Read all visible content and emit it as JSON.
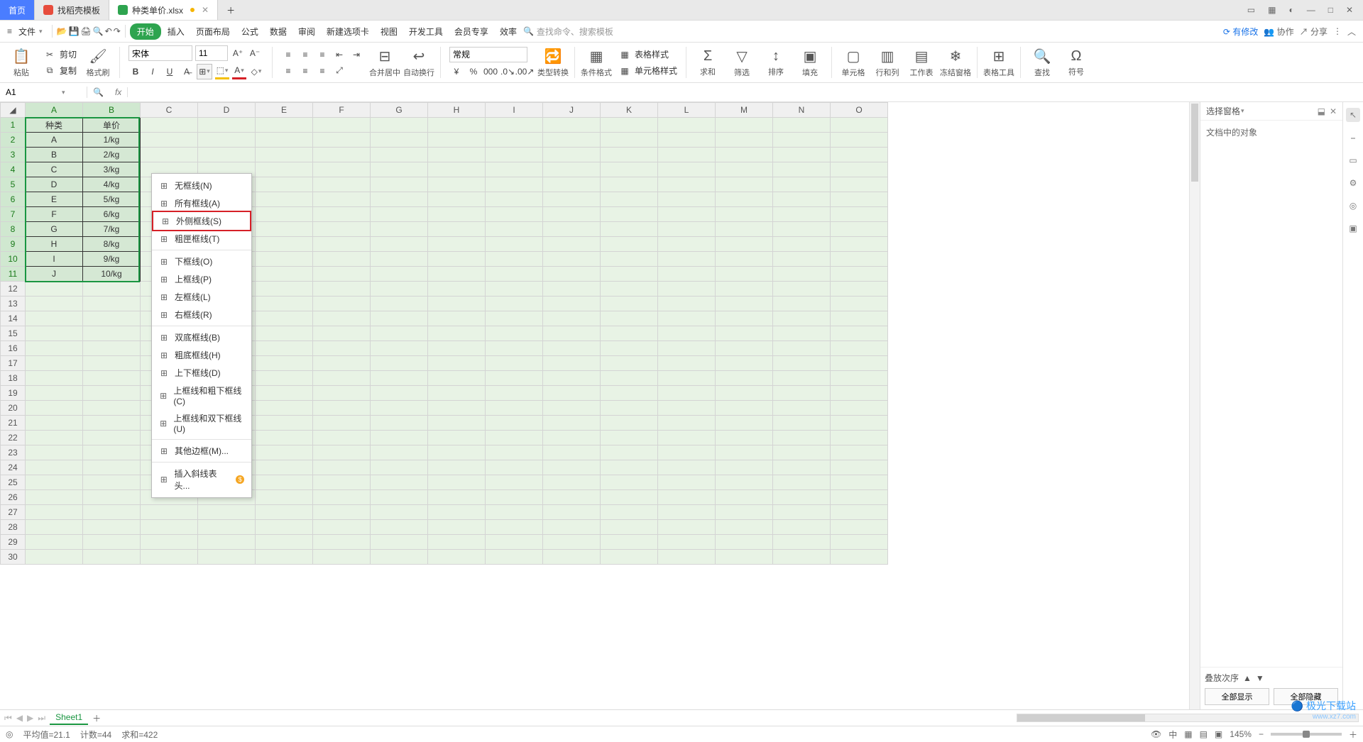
{
  "titlebar": {
    "tabs": [
      {
        "label": "首页",
        "icon_color": "#4a7dff"
      },
      {
        "label": "找稻壳模板",
        "icon_color": "#e74c3c"
      },
      {
        "label": "种类单价.xlsx",
        "icon_color": "#2ea44f"
      }
    ],
    "wincontrols": [
      "▭",
      "⊞",
      "◧",
      "—",
      "□",
      "✕"
    ]
  },
  "menubar": {
    "file": "文件",
    "tabs": [
      "开始",
      "插入",
      "页面布局",
      "公式",
      "数据",
      "审阅",
      "新建选项卡",
      "视图",
      "开发工具",
      "会员专享",
      "效率"
    ],
    "search_placeholder": "查找命令、搜索模板",
    "right": {
      "has_changes": "有修改",
      "collab": "协作",
      "share": "分享"
    }
  },
  "ribbon": {
    "paste": "粘贴",
    "cut": "剪切",
    "copy": "复制",
    "format_painter": "格式刷",
    "font_name": "宋体",
    "font_size": "11",
    "number_format": "常规",
    "merge": "合并居中",
    "wrap": "自动换行",
    "type_convert": "类型转换",
    "cond_fmt": "条件格式",
    "table_style": "表格样式",
    "cell_style": "单元格样式",
    "sum": "求和",
    "filter": "筛选",
    "sort": "排序",
    "fill": "填充",
    "cell": "单元格",
    "row_col": "行和列",
    "sheet": "工作表",
    "freeze": "冻结窗格",
    "table_tools": "表格工具",
    "find": "查找",
    "symbol": "符号"
  },
  "namebox": {
    "cell": "A1"
  },
  "columns": [
    "A",
    "B",
    "C",
    "D",
    "E",
    "F",
    "G",
    "H",
    "I",
    "J",
    "K",
    "L",
    "M",
    "N",
    "O"
  ],
  "table": {
    "headers": [
      "种类",
      "单价"
    ],
    "rows": [
      [
        "A",
        "1/kg"
      ],
      [
        "B",
        "2/kg"
      ],
      [
        "C",
        "3/kg"
      ],
      [
        "D",
        "4/kg"
      ],
      [
        "E",
        "5/kg"
      ],
      [
        "F",
        "6/kg"
      ],
      [
        "G",
        "7/kg"
      ],
      [
        "H",
        "8/kg"
      ],
      [
        "I",
        "9/kg"
      ],
      [
        "J",
        "10/kg"
      ]
    ]
  },
  "grid_rows": 30,
  "border_menu": {
    "items": [
      {
        "label": "无框线(N)"
      },
      {
        "label": "所有框线(A)"
      },
      {
        "label": "外侧框线(S)",
        "hi": true
      },
      {
        "label": "粗匣框线(T)"
      },
      {
        "sep": true
      },
      {
        "label": "下框线(O)"
      },
      {
        "label": "上框线(P)"
      },
      {
        "label": "左框线(L)"
      },
      {
        "label": "右框线(R)"
      },
      {
        "sep": true
      },
      {
        "label": "双底框线(B)"
      },
      {
        "label": "粗底框线(H)"
      },
      {
        "label": "上下框线(D)"
      },
      {
        "label": "上框线和粗下框线(C)"
      },
      {
        "label": "上框线和双下框线(U)"
      },
      {
        "sep": true
      },
      {
        "label": "其他边框(M)..."
      },
      {
        "sep": true
      },
      {
        "label": "插入斜线表头...",
        "vip": true
      }
    ]
  },
  "right_panel": {
    "title": "选择窗格",
    "subtitle": "文档中的对象",
    "stack_label": "叠放次序",
    "show_all": "全部显示",
    "hide_all": "全部隐藏"
  },
  "sheet_tabs": {
    "active": "Sheet1"
  },
  "status": {
    "avg": "平均值=21.1",
    "count": "计数=44",
    "sum": "求和=422",
    "zoom": "145%"
  },
  "watermark": {
    "main": "极光下载站",
    "sub": "www.xz7.com"
  }
}
